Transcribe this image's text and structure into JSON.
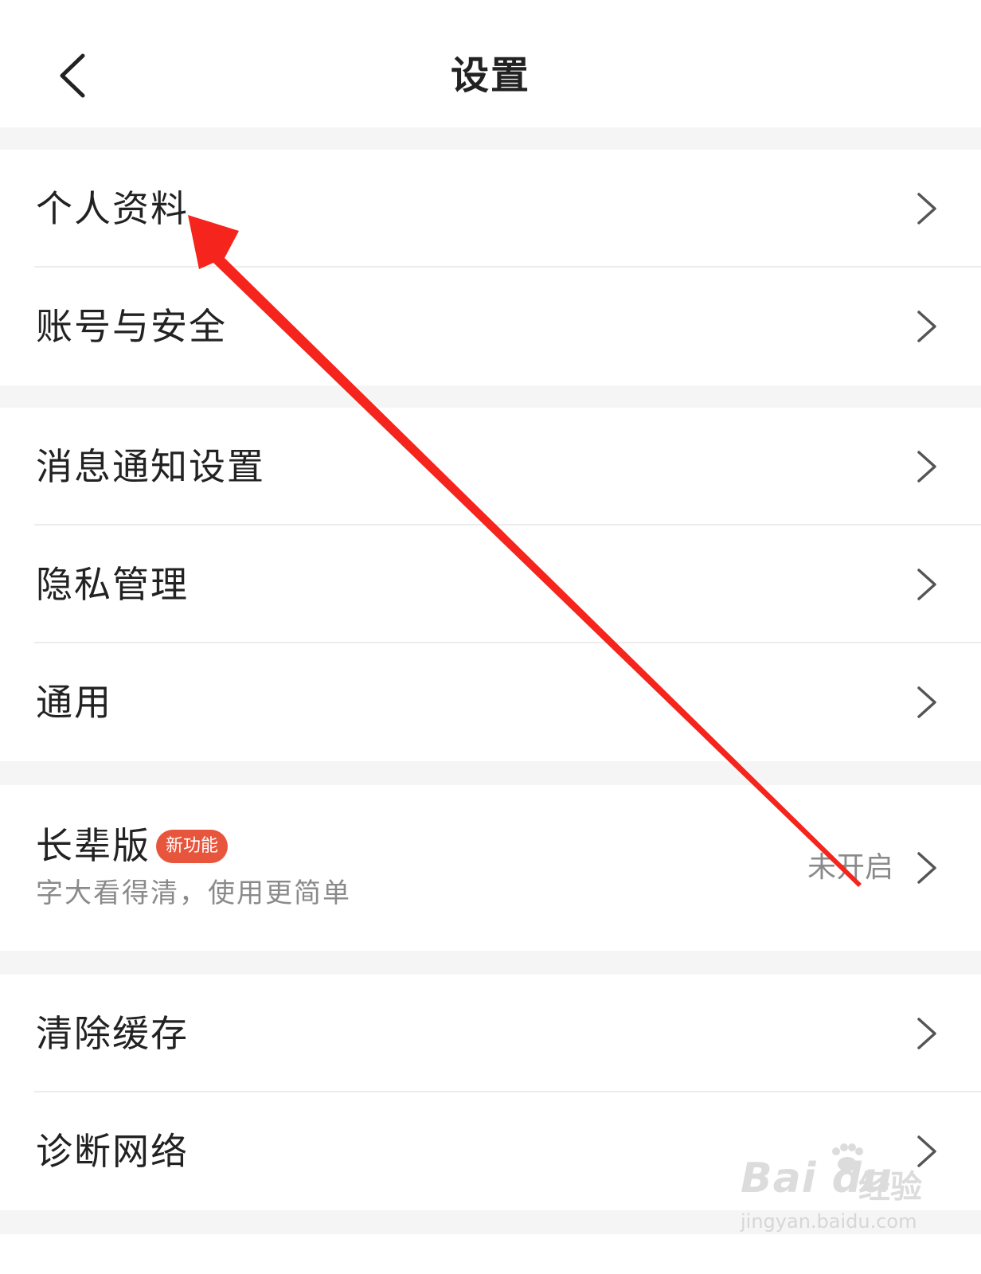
{
  "header": {
    "title": "设置"
  },
  "groups": [
    {
      "items": [
        {
          "label": "个人资料"
        },
        {
          "label": "账号与安全"
        }
      ]
    },
    {
      "items": [
        {
          "label": "消息通知设置"
        },
        {
          "label": "隐私管理"
        },
        {
          "label": "通用"
        }
      ]
    },
    {
      "elder": {
        "title": "长辈版",
        "badge": "新功能",
        "subtitle": "字大看得清，使用更简单",
        "status": "未开启"
      }
    },
    {
      "items": [
        {
          "label": "清除缓存"
        },
        {
          "label": "诊断网络"
        }
      ]
    }
  ],
  "watermark": {
    "logo": "Bai du",
    "brand": "经验",
    "url": "jingyan.baidu.com"
  },
  "colors": {
    "badge": "#e8553d",
    "arrow": "#f5241c",
    "gap": "#f5f5f5",
    "divider": "#ececec"
  }
}
